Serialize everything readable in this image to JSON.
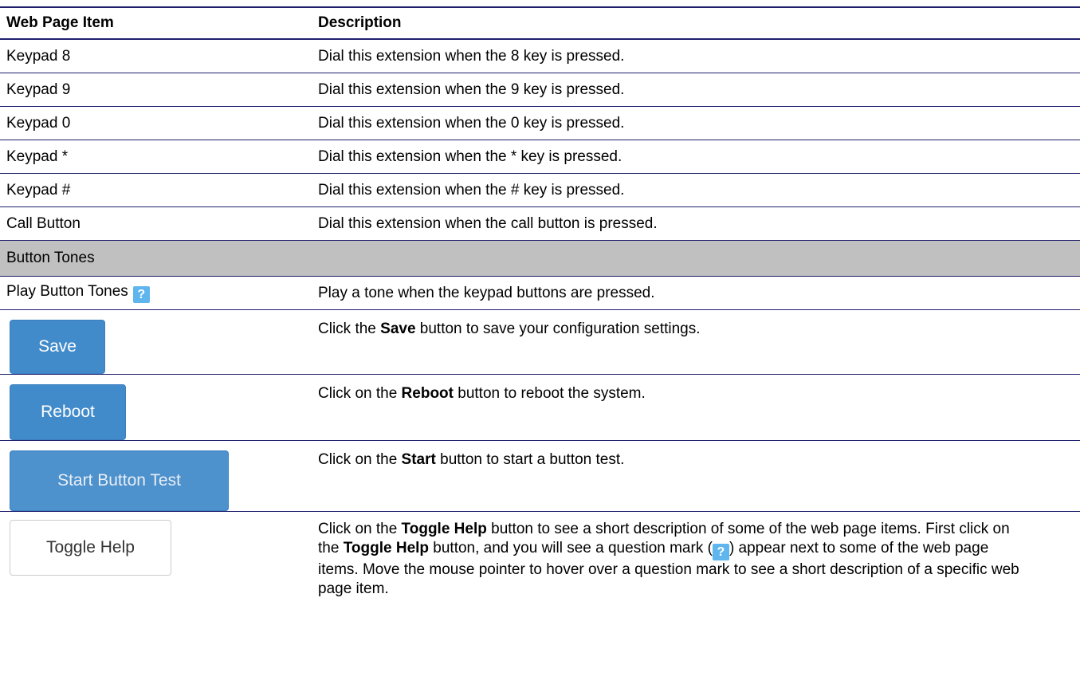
{
  "header": {
    "col1": "Web Page Item",
    "col2": "Description"
  },
  "rows": [
    {
      "item": "Keypad 8",
      "desc": "Dial this extension when the 8 key is pressed."
    },
    {
      "item": "Keypad 9",
      "desc": "Dial this extension when the 9 key is pressed."
    },
    {
      "item": "Keypad 0",
      "desc": "Dial this extension when the 0 key is pressed."
    },
    {
      "item": "Keypad *",
      "desc": "Dial this extension when the * key is pressed."
    },
    {
      "item": "Keypad #",
      "desc": "Dial this extension when the # key is pressed."
    },
    {
      "item": "Call Button",
      "desc": "Dial this extension when the call button is pressed."
    }
  ],
  "section": {
    "label": "Button Tones"
  },
  "play_tones": {
    "item": "Play Button Tones",
    "help_glyph": "?",
    "desc": "Play a tone when the keypad buttons are pressed."
  },
  "save": {
    "button_label": "Save",
    "desc_pre": "Click the ",
    "desc_bold": "Save",
    "desc_post": " button to save your configuration settings."
  },
  "reboot": {
    "button_label": "Reboot",
    "desc_pre": "Click on the ",
    "desc_bold": "Reboot",
    "desc_post": " button to reboot the system."
  },
  "start": {
    "button_label": "Start Button Test",
    "desc_pre": "Click on the ",
    "desc_bold": "Start",
    "desc_post": " button to start a button test."
  },
  "toggle_help": {
    "button_label": "Toggle Help",
    "desc_1": "Click on the ",
    "desc_bold_1": "Toggle Help",
    "desc_2": " button to see a short description of some of the web page items. First click on the ",
    "desc_bold_2": "Toggle Help",
    "desc_3": " button, and you will see a question mark (",
    "help_glyph": "?",
    "desc_4": ") appear next to some of the web page items. Move the mouse pointer to hover over a question mark to see a short description of a specific web page item."
  },
  "colors": {
    "rule": "#1f1f6e",
    "section_bg": "#c0c0c0",
    "primary_button": "#428bca",
    "help_icon": "#5fb6ef"
  }
}
